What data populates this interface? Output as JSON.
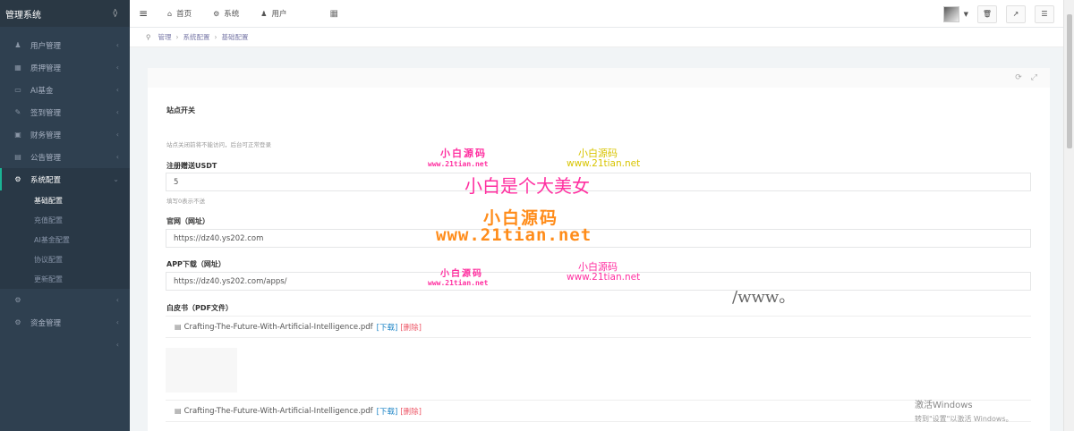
{
  "sidebar": {
    "brand": "管理系统",
    "items": [
      {
        "label": "用户管理",
        "icon": "user-icon",
        "glyph": "♟",
        "arrow": "‹"
      },
      {
        "label": "质押管理",
        "icon": "table-icon",
        "glyph": "▦",
        "arrow": "‹"
      },
      {
        "label": "AI基金",
        "icon": "desktop-icon",
        "glyph": "▭",
        "arrow": "‹"
      },
      {
        "label": "签到管理",
        "icon": "edit-icon",
        "glyph": "✎",
        "arrow": "‹"
      },
      {
        "label": "财务管理",
        "icon": "money-icon",
        "glyph": "▣",
        "arrow": "‹"
      },
      {
        "label": "公告管理",
        "icon": "calendar-icon",
        "glyph": "▤",
        "arrow": "‹"
      }
    ],
    "active": {
      "label": "系统配置",
      "icon": "gears-icon",
      "glyph": "⚙",
      "arrow": "⌄"
    },
    "subitems": [
      "基础配置",
      "充值配置",
      "AI基金配置",
      "协议配置",
      "更新配置"
    ],
    "after": [
      {
        "label": "",
        "icon": "gear-icon",
        "glyph": "⚙",
        "arrow": "‹"
      },
      {
        "label": "资金管理",
        "icon": "gear-icon",
        "glyph": "⚙",
        "arrow": "‹"
      },
      {
        "label": "",
        "icon": "",
        "glyph": "",
        "arrow": "‹"
      }
    ]
  },
  "topbar": {
    "tabs": [
      {
        "label": "首页",
        "icon": "home-icon",
        "glyph": "⌂"
      },
      {
        "label": "系统",
        "icon": "gear-icon",
        "glyph": "⚙"
      },
      {
        "label": "用户",
        "icon": "user-icon",
        "glyph": "♟"
      }
    ]
  },
  "breadcrumb": [
    "管理",
    "系统配置",
    "基础配置"
  ],
  "form": {
    "site_switch_label": "站点开关",
    "site_switch_help": "站点关闭前将不能访问，后台可正常登录",
    "register_usdt_label": "注册赠送USDT",
    "register_usdt_value": "5",
    "register_usdt_help": "填写0表示不送",
    "website_label": "官网（网址）",
    "website_value": "https://dz40.ys202.com",
    "app_label": "APP下载（网址）",
    "app_value": "https://dz40.ys202.com/apps/",
    "whitepaper_label": "白皮书（PDF文件）",
    "files": [
      {
        "name": "Crafting-The-Future-With-Artificial-Intelligence.pdf",
        "download": "[下载]",
        "delete": "[删除]"
      },
      {
        "name": "Crafting-The-Future-With-Artificial-Intelligence.pdf",
        "download": "[下载]",
        "delete": "[删除]"
      }
    ]
  },
  "watermarks": {
    "a1": "小白源码",
    "a2": "www.21tian.net",
    "b1": "小白源码",
    "b2": "www.21tian.net",
    "center1": "小白是个大美女",
    "center2": "小白源码",
    "center3": "www.21tian.net",
    "c1": "小白源码",
    "c2": "www.21tian.net",
    "d1": "小白源码",
    "d2": "www.21tian.net",
    "slash": "/www。"
  },
  "os_overlay": {
    "line1": "激活Windows",
    "line2": "转到\"设置\"以激活 Windows。"
  },
  "colors": {
    "sidebar_bg": "#2f4050",
    "accent_green": "#1ab394",
    "watermark_pink": "#ff2fa0",
    "watermark_orange": "#ff8c1a",
    "watermark_yellow": "#e6c200"
  }
}
